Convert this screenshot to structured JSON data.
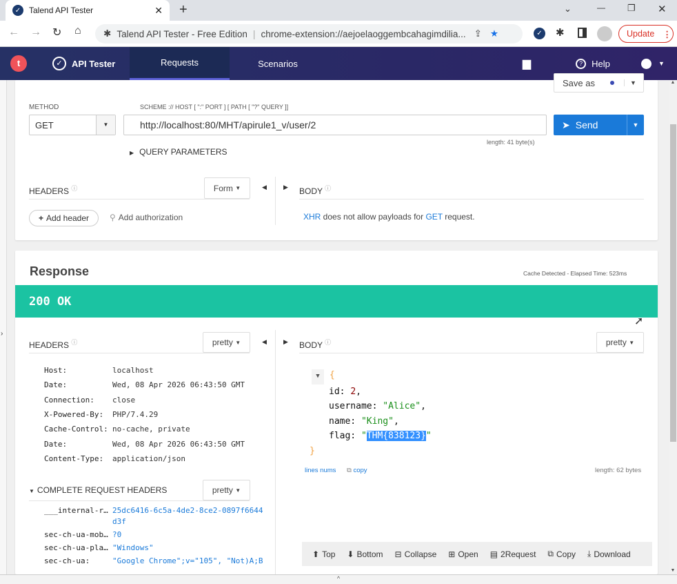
{
  "browser": {
    "tab_title": "Talend API Tester",
    "address_title": "Talend API Tester - Free Edition",
    "url": "chrome-extension://aejoelaoggembcahagimdilia...",
    "update_label": "Update"
  },
  "nav": {
    "logo": "t",
    "app_name": "API Tester",
    "tabs": [
      "Requests",
      "Scenarios"
    ],
    "help": "Help"
  },
  "request": {
    "save_as": "Save as",
    "method_label": "METHOD",
    "method": "GET",
    "url_label": "SCHEME :// HOST [ \":\" PORT ] [ PATH [ \"?\" QUERY ]]",
    "url": "http://localhost:80/MHT/apirule1_v/user/2",
    "length": "length: 41 byte(s)",
    "send": "Send",
    "query_params": "QUERY PARAMETERS",
    "headers_label": "HEADERS",
    "form": "Form",
    "body_label": "BODY",
    "add_header": "Add header",
    "add_auth": "Add authorization",
    "body_msg_xhr": "XHR",
    "body_msg_mid": " does not allow payloads for ",
    "body_msg_get": "GET",
    "body_msg_end": " request."
  },
  "response": {
    "title": "Response",
    "meta": "Cache Detected - Elapsed Time: 523ms",
    "status": "200 OK",
    "status_color": "#1bc3a2",
    "headers_label": "HEADERS",
    "pretty": "pretty",
    "body_label": "BODY",
    "headers": [
      {
        "k": "Host:",
        "v": "localhost"
      },
      {
        "k": "Date:",
        "v": "Wed, 08 Apr 2026 06:43:50 GMT"
      },
      {
        "k": "Connection:",
        "v": "close"
      },
      {
        "k": "X-Powered-By:",
        "v": "PHP/7.4.29"
      },
      {
        "k": "Cache-Control:",
        "v": "no-cache, private"
      },
      {
        "k": "Date:",
        "v": "Wed, 08 Apr 2026 06:43:50 GMT"
      },
      {
        "k": "Content-Type:",
        "v": "application/json"
      }
    ],
    "complete_headers_label": "COMPLETE REQUEST HEADERS",
    "complete_headers": [
      {
        "k": "___internal-r…",
        "v": "25dc6416-6c5a-4de2-8ce2-0897f6644",
        "v2": "d3f"
      },
      {
        "k": "sec-ch-ua-mob…",
        "v": "?0"
      },
      {
        "k": "sec-ch-ua-pla…",
        "v": "\"Windows\""
      },
      {
        "k": "sec-ch-ua:",
        "v": "\"Google Chrome\";v=\"105\", \"Not)A;B"
      }
    ],
    "body": {
      "open": "{",
      "close": "}",
      "id_key": "id:",
      "id_val": "2",
      "username_key": "username:",
      "username_val": "\"Alice\"",
      "name_key": "name:",
      "name_val": "\"King\"",
      "flag_key": "flag:",
      "flag_q": "\"",
      "flag_val": "THM{838123}"
    },
    "lines_nums": "lines nums",
    "copy": "copy",
    "body_length": "length: 62 bytes",
    "toolbar": [
      "Top",
      "Bottom",
      "Collapse",
      "Open",
      "2Request",
      "Copy",
      "Download"
    ]
  }
}
